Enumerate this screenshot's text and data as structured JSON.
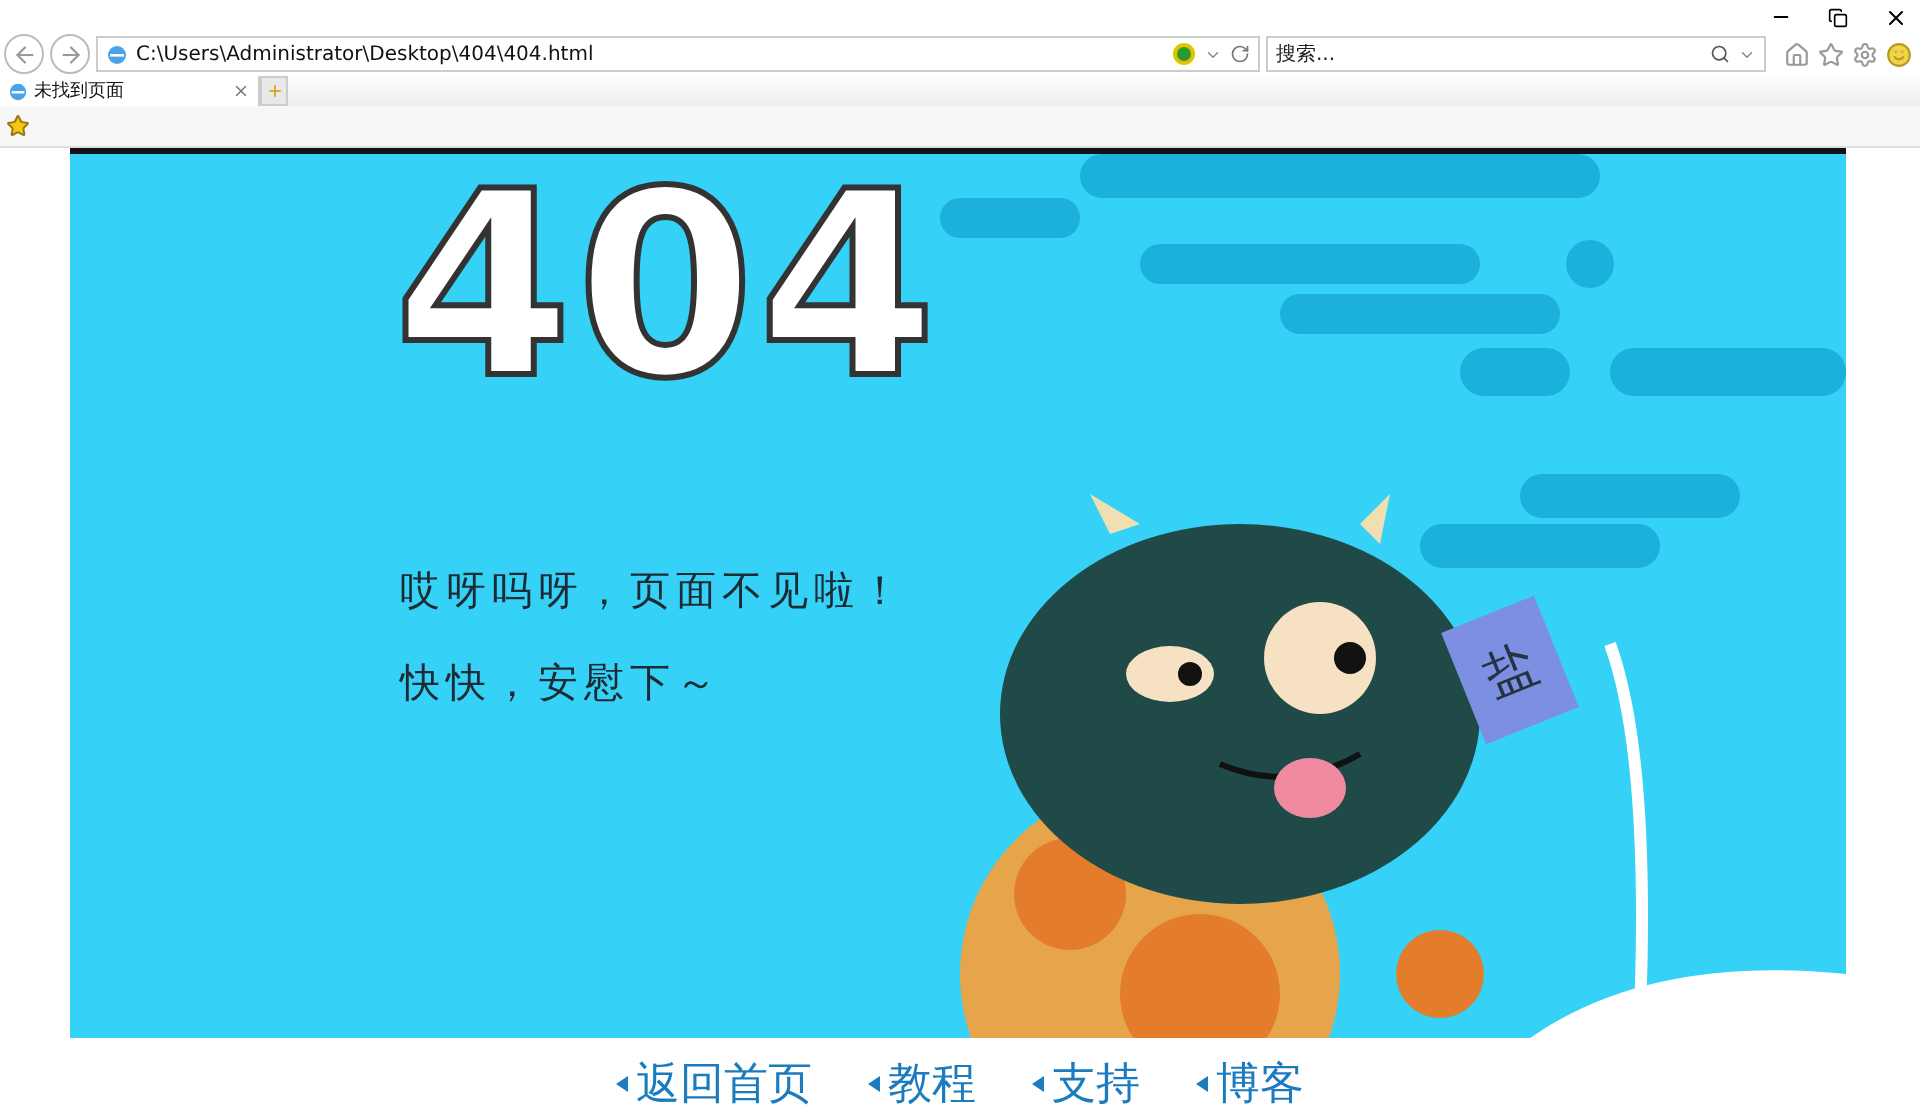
{
  "browser": {
    "address": "C:\\Users\\Administrator\\Desktop\\404\\404.html",
    "search": {
      "placeholder": "搜索..."
    },
    "tabs": [
      {
        "label": "未找到页面",
        "selected": true
      }
    ]
  },
  "illustration": {
    "heading": "404",
    "lines": [
      "哎呀吗呀，页面不见啦！",
      "快快，安慰下～"
    ],
    "sign": "盐"
  },
  "links": [
    "返回首页",
    "教程",
    "支持",
    "博客"
  ]
}
